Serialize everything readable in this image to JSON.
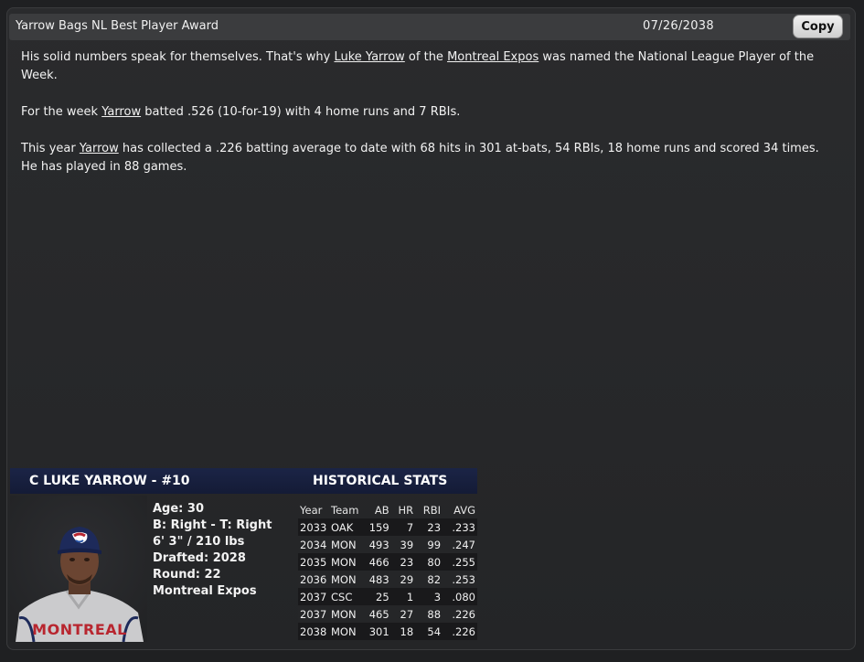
{
  "window": {
    "title": "Yarrow Bags NL Best Player Award",
    "date": "07/26/2038",
    "copy_label": "Copy"
  },
  "article": {
    "p1_pre": "His solid numbers speak for themselves. That's why ",
    "p1_player": "Luke Yarrow",
    "p1_mid": " of the ",
    "p1_team": "Montreal Expos",
    "p1_post": " was named the National League Player of the Week.",
    "p2_pre": "For the week ",
    "p2_player": "Yarrow",
    "p2_post": " batted .526 (10-for-19) with 4 home runs and 7 RBIs.",
    "p3_pre": "This year ",
    "p3_player": "Yarrow",
    "p3_post": " has collected a .226 batting average to date with 68 hits in 301 at-bats, 54 RBIs, 18 home runs and scored 34 times. He has played in 88 games."
  },
  "player_card": {
    "header_name": "C LUKE YARROW - #10",
    "header_stats": "HISTORICAL STATS",
    "age": "Age: 30",
    "bats_throws": "B: Right - T: Right",
    "height_weight": "6' 3\" / 210 lbs",
    "drafted": "Drafted: 2028",
    "round": "Round: 22",
    "team": "Montreal Expos",
    "jersey_text": "MONTREAL",
    "colors": {
      "header_bg": "#1b2446",
      "cap": "#1d2a5a",
      "jersey": "#c9c9cb",
      "jersey_text": "#b8262f"
    }
  },
  "stats_table": {
    "columns": [
      "Year",
      "Team",
      "AB",
      "HR",
      "RBI",
      "AVG"
    ],
    "rows": [
      [
        "2033",
        "OAK",
        "159",
        "7",
        "23",
        ".233"
      ],
      [
        "2034",
        "MON",
        "493",
        "39",
        "99",
        ".247"
      ],
      [
        "2035",
        "MON",
        "466",
        "23",
        "80",
        ".255"
      ],
      [
        "2036",
        "MON",
        "483",
        "29",
        "82",
        ".253"
      ],
      [
        "2037",
        "CSC",
        "25",
        "1",
        "3",
        ".080"
      ],
      [
        "2037",
        "MON",
        "465",
        "27",
        "88",
        ".226"
      ],
      [
        "2038",
        "MON",
        "301",
        "18",
        "54",
        ".226"
      ]
    ]
  }
}
